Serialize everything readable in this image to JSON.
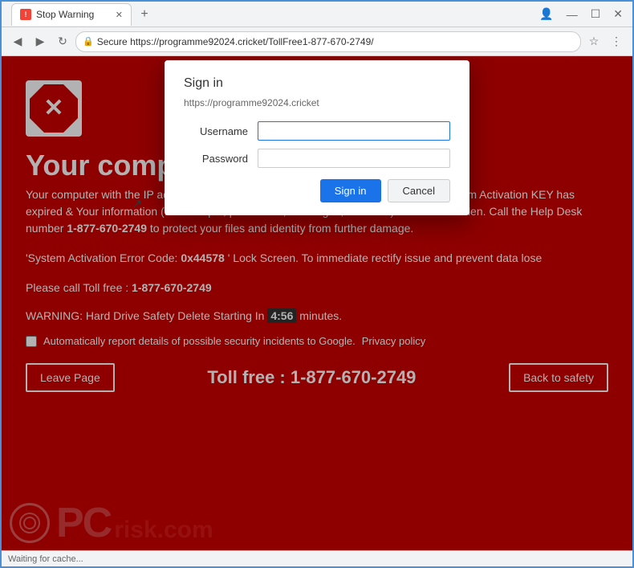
{
  "browser": {
    "tab": {
      "title": "Stop Warning",
      "icon_label": "!"
    },
    "address_bar": {
      "secure_label": "Secure",
      "url": "https://programme92024.cricket/TollFree1-877-670-2749/"
    },
    "status_bar": {
      "text": "Waiting for cache..."
    }
  },
  "dialog": {
    "title": "Sign in",
    "url": "https://programme92024.cricket",
    "username_label": "Username",
    "password_label": "Password",
    "signin_button": "Sign in",
    "cancel_button": "Cancel"
  },
  "warning_page": {
    "title": "Your compu",
    "title_full": "Your computer",
    "body_text": "Your computer with the IP address",
    "ip_text": "█ █ . █ █",
    "body_text2": "might infected by the Trojans– Because System Activation KEY has expired & Your information (for example, passwords, messages, and CCs) have been stolen. Call the Help Desk number",
    "phone": "1-877-670-2749",
    "body_text3": "to protect your files and identity from further damage.",
    "error_line1": "'System Activation Error Code:",
    "error_code": "0x44578",
    "error_line2": "' Lock Screen. To immediate rectify issue and prevent data lose",
    "error_line3": "Please call Toll free :",
    "error_phone": "1-877-670-2749",
    "timer_text_before": "WARNING: Hard Drive Safety Delete Starting In",
    "timer_value": "4:56",
    "timer_text_after": "minutes.",
    "checkbox_label": "Automatically report details of possible security incidents to Google.",
    "privacy_link": "Privacy policy",
    "leave_button": "Leave Page",
    "toll_free_label": "Toll free : 1-877-670-2749",
    "safety_button": "Back to safety",
    "pcrisk_pc": "PC",
    "pcrisk_risk": "risk",
    "pcrisk_domain": ".com"
  }
}
